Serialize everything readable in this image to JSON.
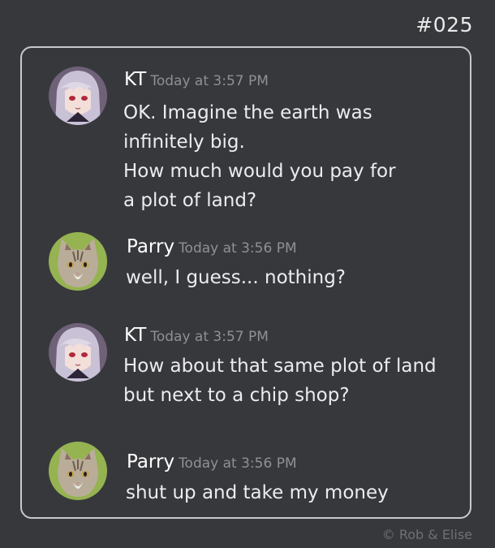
{
  "comic_number": "#025",
  "messages": [
    {
      "author": "KT",
      "timestamp": "Today at 3:57 PM",
      "lines": [
        "OK.  Imagine the earth was",
        "infinitely big.",
        "How much would you pay for",
        "a plot of land?"
      ],
      "avatar": "anime-girl-avatar-icon"
    },
    {
      "author": "Parry",
      "timestamp": "Today at 3:56 PM",
      "lines": [
        "well, I guess... nothing?"
      ],
      "avatar": "cat-avatar-icon"
    },
    {
      "author": "KT",
      "timestamp": "Today at 3:57 PM",
      "lines": [
        "How about that same plot of land",
        "but next to a chip shop?"
      ],
      "avatar": "anime-girl-avatar-icon"
    },
    {
      "author": "Parry",
      "timestamp": "Today at 3:56 PM",
      "lines": [
        "shut up and take my money"
      ],
      "avatar": "cat-avatar-icon"
    }
  ],
  "copyright": "©  Rob & Elise",
  "colors": {
    "background": "#37383c",
    "frame_border": "#c9c9cb",
    "author": "#ffffff",
    "timestamp": "#8e9096",
    "message_text": "#ececee"
  }
}
